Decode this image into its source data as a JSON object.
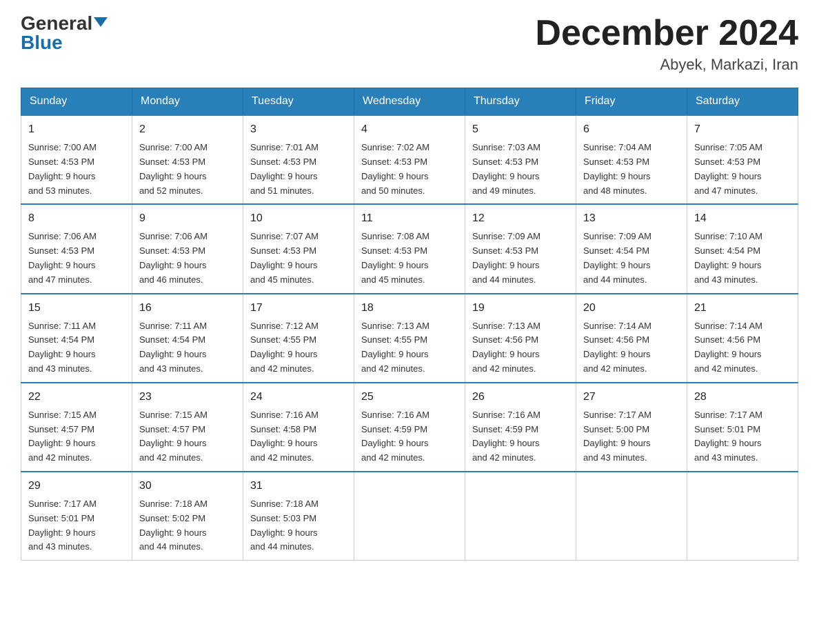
{
  "logo": {
    "general": "General",
    "blue": "Blue"
  },
  "title": "December 2024",
  "location": "Abyek, Markazi, Iran",
  "days_header": [
    "Sunday",
    "Monday",
    "Tuesday",
    "Wednesday",
    "Thursday",
    "Friday",
    "Saturday"
  ],
  "weeks": [
    [
      {
        "day": "1",
        "sunrise": "7:00 AM",
        "sunset": "4:53 PM",
        "daylight": "9 hours and 53 minutes."
      },
      {
        "day": "2",
        "sunrise": "7:00 AM",
        "sunset": "4:53 PM",
        "daylight": "9 hours and 52 minutes."
      },
      {
        "day": "3",
        "sunrise": "7:01 AM",
        "sunset": "4:53 PM",
        "daylight": "9 hours and 51 minutes."
      },
      {
        "day": "4",
        "sunrise": "7:02 AM",
        "sunset": "4:53 PM",
        "daylight": "9 hours and 50 minutes."
      },
      {
        "day": "5",
        "sunrise": "7:03 AM",
        "sunset": "4:53 PM",
        "daylight": "9 hours and 49 minutes."
      },
      {
        "day": "6",
        "sunrise": "7:04 AM",
        "sunset": "4:53 PM",
        "daylight": "9 hours and 48 minutes."
      },
      {
        "day": "7",
        "sunrise": "7:05 AM",
        "sunset": "4:53 PM",
        "daylight": "9 hours and 47 minutes."
      }
    ],
    [
      {
        "day": "8",
        "sunrise": "7:06 AM",
        "sunset": "4:53 PM",
        "daylight": "9 hours and 47 minutes."
      },
      {
        "day": "9",
        "sunrise": "7:06 AM",
        "sunset": "4:53 PM",
        "daylight": "9 hours and 46 minutes."
      },
      {
        "day": "10",
        "sunrise": "7:07 AM",
        "sunset": "4:53 PM",
        "daylight": "9 hours and 45 minutes."
      },
      {
        "day": "11",
        "sunrise": "7:08 AM",
        "sunset": "4:53 PM",
        "daylight": "9 hours and 45 minutes."
      },
      {
        "day": "12",
        "sunrise": "7:09 AM",
        "sunset": "4:53 PM",
        "daylight": "9 hours and 44 minutes."
      },
      {
        "day": "13",
        "sunrise": "7:09 AM",
        "sunset": "4:54 PM",
        "daylight": "9 hours and 44 minutes."
      },
      {
        "day": "14",
        "sunrise": "7:10 AM",
        "sunset": "4:54 PM",
        "daylight": "9 hours and 43 minutes."
      }
    ],
    [
      {
        "day": "15",
        "sunrise": "7:11 AM",
        "sunset": "4:54 PM",
        "daylight": "9 hours and 43 minutes."
      },
      {
        "day": "16",
        "sunrise": "7:11 AM",
        "sunset": "4:54 PM",
        "daylight": "9 hours and 43 minutes."
      },
      {
        "day": "17",
        "sunrise": "7:12 AM",
        "sunset": "4:55 PM",
        "daylight": "9 hours and 42 minutes."
      },
      {
        "day": "18",
        "sunrise": "7:13 AM",
        "sunset": "4:55 PM",
        "daylight": "9 hours and 42 minutes."
      },
      {
        "day": "19",
        "sunrise": "7:13 AM",
        "sunset": "4:56 PM",
        "daylight": "9 hours and 42 minutes."
      },
      {
        "day": "20",
        "sunrise": "7:14 AM",
        "sunset": "4:56 PM",
        "daylight": "9 hours and 42 minutes."
      },
      {
        "day": "21",
        "sunrise": "7:14 AM",
        "sunset": "4:56 PM",
        "daylight": "9 hours and 42 minutes."
      }
    ],
    [
      {
        "day": "22",
        "sunrise": "7:15 AM",
        "sunset": "4:57 PM",
        "daylight": "9 hours and 42 minutes."
      },
      {
        "day": "23",
        "sunrise": "7:15 AM",
        "sunset": "4:57 PM",
        "daylight": "9 hours and 42 minutes."
      },
      {
        "day": "24",
        "sunrise": "7:16 AM",
        "sunset": "4:58 PM",
        "daylight": "9 hours and 42 minutes."
      },
      {
        "day": "25",
        "sunrise": "7:16 AM",
        "sunset": "4:59 PM",
        "daylight": "9 hours and 42 minutes."
      },
      {
        "day": "26",
        "sunrise": "7:16 AM",
        "sunset": "4:59 PM",
        "daylight": "9 hours and 42 minutes."
      },
      {
        "day": "27",
        "sunrise": "7:17 AM",
        "sunset": "5:00 PM",
        "daylight": "9 hours and 43 minutes."
      },
      {
        "day": "28",
        "sunrise": "7:17 AM",
        "sunset": "5:01 PM",
        "daylight": "9 hours and 43 minutes."
      }
    ],
    [
      {
        "day": "29",
        "sunrise": "7:17 AM",
        "sunset": "5:01 PM",
        "daylight": "9 hours and 43 minutes."
      },
      {
        "day": "30",
        "sunrise": "7:18 AM",
        "sunset": "5:02 PM",
        "daylight": "9 hours and 44 minutes."
      },
      {
        "day": "31",
        "sunrise": "7:18 AM",
        "sunset": "5:03 PM",
        "daylight": "9 hours and 44 minutes."
      },
      null,
      null,
      null,
      null
    ]
  ],
  "labels": {
    "sunrise": "Sunrise:",
    "sunset": "Sunset:",
    "daylight": "Daylight:"
  }
}
